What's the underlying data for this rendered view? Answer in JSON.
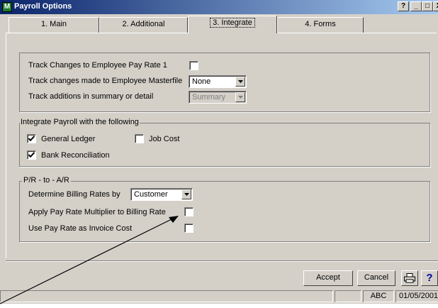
{
  "window": {
    "title": "Payroll Options",
    "controls": [
      "?",
      "_",
      "□",
      "X"
    ]
  },
  "tabs": [
    {
      "label": "1. Main",
      "active": false
    },
    {
      "label": "2. Additional",
      "active": false
    },
    {
      "label": "3. Integrate",
      "active": true
    },
    {
      "label": "4. Forms",
      "active": false
    }
  ],
  "tracking": {
    "rows": [
      {
        "label": "Track Changes to Employee Pay Rate 1",
        "checked": false
      },
      {
        "label": "Track changes made to Employee Masterfile",
        "value": "None",
        "enabled": true
      },
      {
        "label": "Track additions in summary or detail",
        "value": "Summary",
        "enabled": false
      }
    ]
  },
  "integrate": {
    "title": "Integrate Payroll with the following",
    "general_ledger": {
      "label": "General Ledger",
      "checked": true
    },
    "job_cost": {
      "label": "Job Cost",
      "checked": false
    },
    "bank_reconciliation": {
      "label": "Bank Reconciliation",
      "checked": true
    }
  },
  "pr_ar": {
    "title": "P/R - to - A/R",
    "billing_rates": {
      "label": "Determine Billing Rates by",
      "value": "Customer"
    },
    "multiplier": {
      "label": "Apply Pay Rate Multiplier to Billing Rate",
      "checked": false
    },
    "invoice_cost": {
      "label": "Use Pay Rate as Invoice Cost",
      "checked": false
    }
  },
  "buttons": {
    "accept": "Accept",
    "cancel": "Cancel",
    "help": "?"
  },
  "status": {
    "abc": "ABC",
    "date": "01/05/2001"
  }
}
